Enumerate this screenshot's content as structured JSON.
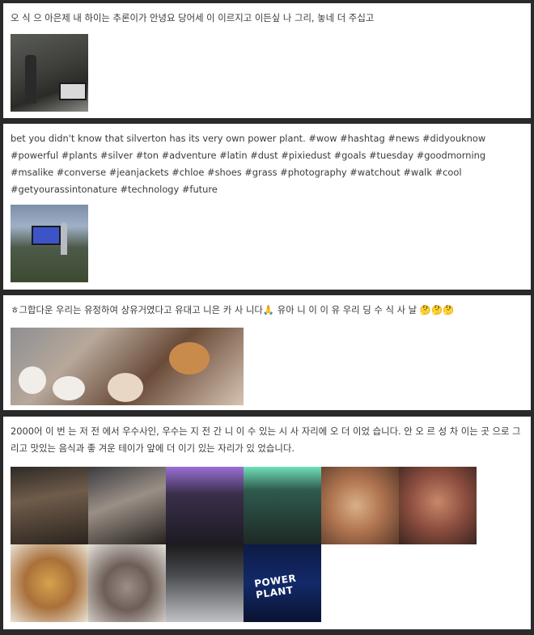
{
  "posts": [
    {
      "text": "오 식 으 아은제 내 하이는 추론이가 안녕요 당어세 이 이르지고 이든싶 나 그리, 놓네 더 주십고",
      "images": [
        {
          "icon": "office-photo"
        }
      ]
    },
    {
      "text": "bet you didn't know that silverton has its very own power plant. #wow #hashtag #news #didyouknow #powerful #plants #silver #ton #adventure #latin #dust #pixiedust #goals #tuesday #goodmorning #msalike #converse #jeanjackets #chloe #shoes #grass #photography #watchout #walk #cool #getyourassintonature #technology #future",
      "images": [
        {
          "icon": "power-plant-photo"
        }
      ]
    },
    {
      "text": "ㅎ그합다운 우리는 유정하여 상유거였다고 유대고 니은 카 사 니다🙏 유아 니 이 이 유 우리 딩 수 식 사 날 🤔🤔🤔",
      "images": [
        {
          "icon": "restaurant-table-photo"
        }
      ]
    },
    {
      "text": "2000어 이 번 는 저 전 에서 우수사인, 우수는 지 전 간 니 이 수 있는 시 사 자리에 오 더 이었 습니다. 안 오 르 성 차 이는 곳 으로 그리고 맛있는 음식과 좋 겨운 테이가 앞에 더 이기 있는 자리가 있 었습니다.",
      "images": [
        {
          "icon": "group-photo"
        },
        {
          "icon": "friends-photo"
        },
        {
          "icon": "purple-venue-photo"
        },
        {
          "icon": "green-venue-photo"
        },
        {
          "icon": "pizza-photo"
        },
        {
          "icon": "pizza-closeup-photo"
        },
        {
          "icon": "pasta-photo"
        },
        {
          "icon": "bowl-photo"
        },
        {
          "icon": "venue-hall-photo"
        },
        {
          "icon": "power-plant-sign-photo"
        }
      ],
      "sign_text": "POWER PLANT"
    }
  ]
}
